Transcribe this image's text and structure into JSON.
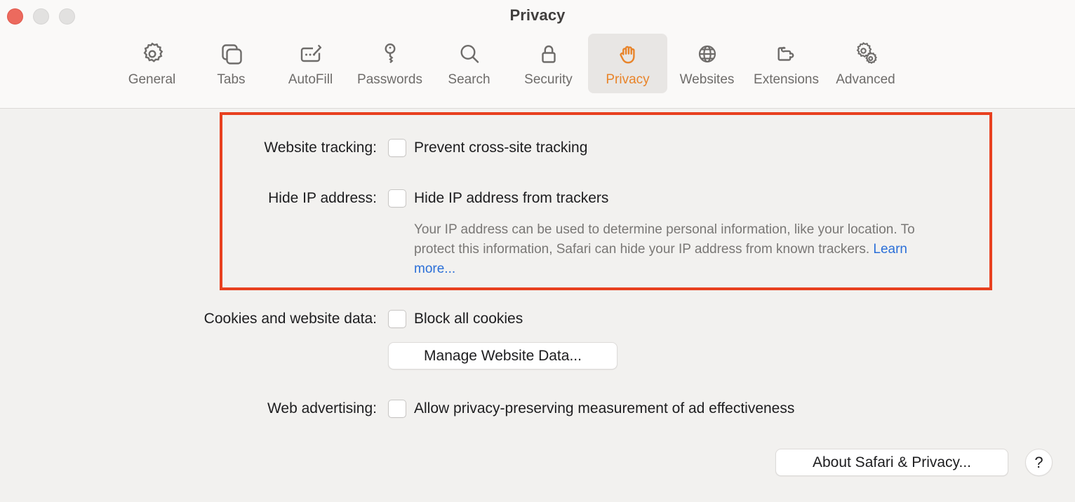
{
  "window": {
    "title": "Privacy",
    "traffic_lights": [
      {
        "name": "close",
        "color": "#ec6a5e"
      },
      {
        "name": "minimize",
        "color": "#e2e1e0"
      },
      {
        "name": "maximize",
        "color": "#e2e1e0"
      }
    ]
  },
  "toolbar": {
    "selected": "Privacy",
    "accent_color": "#e8842a",
    "items": [
      {
        "label": "General",
        "icon": "gear-icon"
      },
      {
        "label": "Tabs",
        "icon": "tabs-icon"
      },
      {
        "label": "AutoFill",
        "icon": "autofill-icon"
      },
      {
        "label": "Passwords",
        "icon": "key-icon"
      },
      {
        "label": "Search",
        "icon": "search-icon"
      },
      {
        "label": "Security",
        "icon": "lock-icon"
      },
      {
        "label": "Privacy",
        "icon": "hand-icon"
      },
      {
        "label": "Websites",
        "icon": "globe-icon"
      },
      {
        "label": "Extensions",
        "icon": "puzzle-icon"
      },
      {
        "label": "Advanced",
        "icon": "gears-icon"
      }
    ]
  },
  "highlight": {
    "color": "#e8401f"
  },
  "settings": {
    "website_tracking": {
      "label": "Website tracking:",
      "checkbox_label": "Prevent cross-site tracking",
      "checked": false
    },
    "hide_ip_address": {
      "label": "Hide IP address:",
      "checkbox_label": "Hide IP address from trackers",
      "checked": false,
      "description": "Your IP address can be used to determine personal information, like your location. To protect this information, Safari can hide your IP address from known trackers. ",
      "link_label": "Learn more..."
    },
    "cookies": {
      "label": "Cookies and website data:",
      "checkbox_label": "Block all cookies",
      "checked": false,
      "button_label": "Manage Website Data..."
    },
    "web_advertising": {
      "label": "Web advertising:",
      "checkbox_label": "Allow privacy-preserving measurement of ad effectiveness",
      "checked": false
    }
  },
  "footer": {
    "about_label": "About Safari & Privacy...",
    "help_label": "?"
  }
}
